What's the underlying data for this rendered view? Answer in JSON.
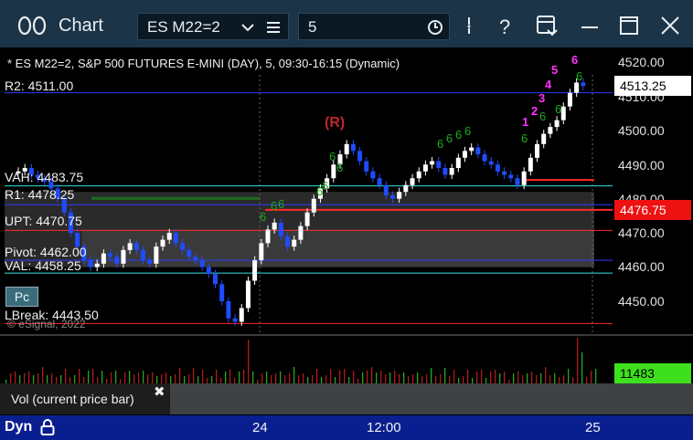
{
  "window": {
    "title": "Chart",
    "title_icon": "link-circles-icon",
    "symbol_combo": "ES M22=2",
    "interval_combo": "5",
    "icons": [
      "chevron-down-icon",
      "menu-icon",
      "clock-icon",
      "settings-icon",
      "help-icon",
      "template-icon",
      "minimize-icon",
      "maximize-icon",
      "close-icon"
    ]
  },
  "chart": {
    "header": "* ES M22=2, S&P 500 FUTURES E-MINI (DAY), 5, 09:30-16:15 (Dynamic)",
    "copyright": "© eSignal, 2022",
    "pc_button": "Pc",
    "levels": [
      {
        "label": "R2: 4511.00",
        "price": 4511.0,
        "color": "#2a3cff"
      },
      {
        "label": "VAH: 4483.75",
        "price": 4483.75,
        "color": "#35e0e0"
      },
      {
        "label": "R1: 4478.25",
        "price": 4478.25,
        "color": "#2a3cff"
      },
      {
        "label": "UPT: 4470.75",
        "price": 4470.75,
        "color": "#ff2a2a"
      },
      {
        "label": "Pivot: 4462.00",
        "price": 4462.0,
        "color": "#2a3cff"
      },
      {
        "label": "VAL: 4458.25",
        "price": 4458.25,
        "color": "#35e0e0"
      },
      {
        "label": "LBreak: 4443.50",
        "price": 4443.5,
        "color": "#ff2a2a"
      }
    ],
    "annotations": [
      {
        "text": "(R)",
        "color": "#c0262a"
      },
      {
        "text": "1",
        "color": "#ff30ff"
      },
      {
        "text": "2",
        "color": "#ff30ff"
      },
      {
        "text": "3",
        "color": "#ff30ff"
      },
      {
        "text": "4",
        "color": "#ff30ff"
      },
      {
        "text": "5",
        "color": "#ff30ff"
      },
      {
        "text": "6",
        "color": "#ff30ff"
      }
    ]
  },
  "chart_data": {
    "type": "candlestick",
    "y_ticks": [
      4520,
      4510,
      4500,
      4490,
      4480,
      4470,
      4460,
      4450
    ],
    "y_tick_labels": [
      "4520.00",
      "4510.00",
      "4500.00",
      "4490.00",
      "4480.00",
      "4470.00",
      "4460.00",
      "4450.00"
    ],
    "ylim": [
      4440,
      4523
    ],
    "x_ticks": [
      "24",
      "12:00",
      "25"
    ],
    "current_price": "4513.25",
    "upt_price": "4476.75",
    "volume": "11483"
  },
  "volume_panel": {
    "label": "Vol (current price bar)",
    "close": "✖"
  },
  "timebar": {
    "label": "Dyn"
  },
  "colors": {
    "titlebar": "#1c3447",
    "up_candle": "#ffffff",
    "down_candle": "#1f4cff",
    "timebar": "#0a1f8f"
  }
}
